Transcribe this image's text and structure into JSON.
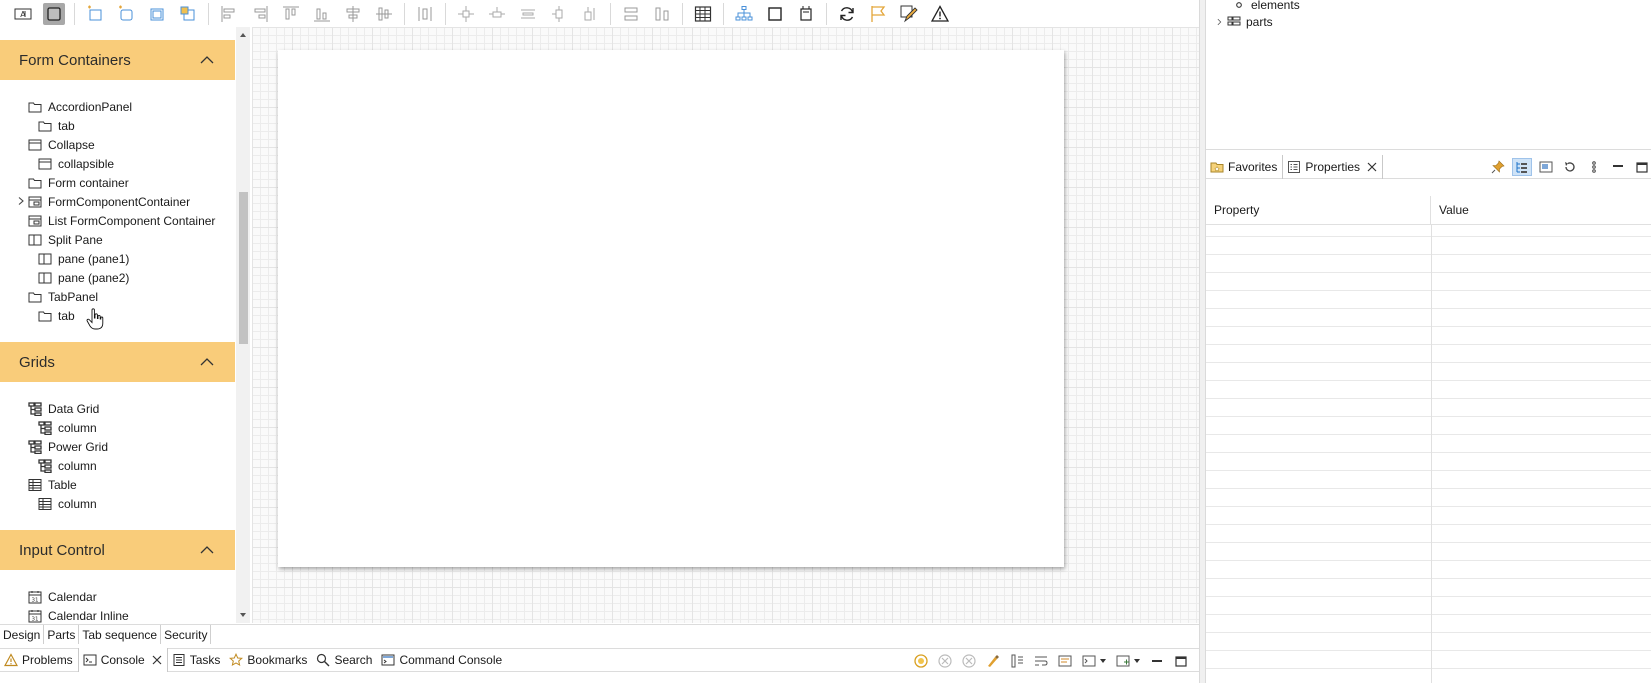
{
  "toolbar": {
    "buttons": [
      "label-icon",
      "rect-icon",
      "new-form-icon",
      "new-form-2-icon",
      "new-form-3-icon",
      "new-form-4-icon",
      "align-left-icon",
      "align-right-icon",
      "align-top-icon",
      "align-bottom-icon",
      "align-center-icon",
      "align-middle-icon",
      "distribute-icon",
      "anchor-1-icon",
      "anchor-2-icon",
      "anchor-3-icon",
      "anchor-4-icon",
      "anchor-5-icon",
      "same-width-icon",
      "same-height-icon",
      "grid-icon",
      "tree-icon",
      "bounds-icon",
      "crop-icon",
      "refresh-icon",
      "flag-icon",
      "pencil-icon",
      "warning-icon"
    ]
  },
  "palette": {
    "sections": [
      {
        "title": "Form Containers",
        "items": [
          {
            "label": "AccordionPanel",
            "level": 0,
            "icon": "folder-icon"
          },
          {
            "label": "tab",
            "level": 1,
            "icon": "folder-icon"
          },
          {
            "label": "Collapse",
            "level": 0,
            "icon": "collapse-icon"
          },
          {
            "label": "collapsible",
            "level": 1,
            "icon": "collapse-icon"
          },
          {
            "label": "Form container",
            "level": 0,
            "icon": "folder-icon"
          },
          {
            "label": "FormComponentContainer",
            "level": 0,
            "icon": "formcomponent-icon",
            "expandable": true
          },
          {
            "label": "List FormComponent Container",
            "level": 0,
            "icon": "formcomponent-icon"
          },
          {
            "label": "Split Pane",
            "level": 0,
            "icon": "splitpane-icon"
          },
          {
            "label": "pane (pane1)",
            "level": 1,
            "icon": "splitpane-icon"
          },
          {
            "label": "pane (pane2)",
            "level": 1,
            "icon": "splitpane-icon"
          },
          {
            "label": "TabPanel",
            "level": 0,
            "icon": "folder-icon"
          },
          {
            "label": "tab",
            "level": 1,
            "icon": "folder-icon"
          }
        ]
      },
      {
        "title": "Grids",
        "items": [
          {
            "label": "Data Grid",
            "level": 0,
            "icon": "datagrid-icon"
          },
          {
            "label": "column",
            "level": 1,
            "icon": "datagrid-icon"
          },
          {
            "label": "Power Grid",
            "level": 0,
            "icon": "datagrid-icon"
          },
          {
            "label": "column",
            "level": 1,
            "icon": "datagrid-icon"
          },
          {
            "label": "Table",
            "level": 0,
            "icon": "table-icon"
          },
          {
            "label": "column",
            "level": 1,
            "icon": "table-icon"
          }
        ]
      },
      {
        "title": "Input Control",
        "items": [
          {
            "label": "Calendar",
            "level": 0,
            "icon": "calendar-icon"
          },
          {
            "label": "Calendar Inline",
            "level": 0,
            "icon": "calendar-icon"
          }
        ]
      }
    ]
  },
  "editor_tabs": [
    "Design",
    "Parts",
    "Tab sequence",
    "Security"
  ],
  "bottom_tabs": [
    {
      "label": "Problems",
      "icon": "problems-icon"
    },
    {
      "label": "Console",
      "icon": "console-icon",
      "active": true,
      "closable": true
    },
    {
      "label": "Tasks",
      "icon": "tasks-icon"
    },
    {
      "label": "Bookmarks",
      "icon": "bookmark-icon"
    },
    {
      "label": "Search",
      "icon": "search-icon"
    },
    {
      "label": "Command Console",
      "icon": "command-console-icon"
    }
  ],
  "right_tree": {
    "items": [
      {
        "label": "elements",
        "icon": "bullet-icon"
      },
      {
        "label": "parts",
        "icon": "parts-icon",
        "expandable": true
      }
    ]
  },
  "right_panel": {
    "tabs": [
      {
        "label": "Favorites",
        "icon": "favorites-icon"
      },
      {
        "label": "Properties",
        "icon": "properties-icon",
        "active": true,
        "closable": true
      }
    ],
    "columns": [
      "Property",
      "Value"
    ]
  },
  "colors": {
    "palette_header": "#f9cc7a",
    "accent": "#1e73c8"
  }
}
